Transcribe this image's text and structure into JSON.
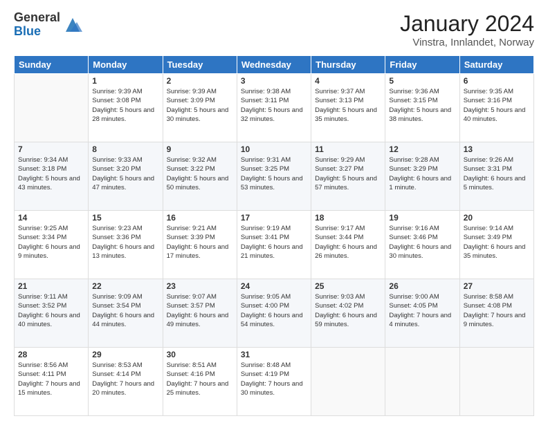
{
  "header": {
    "logo": {
      "general": "General",
      "blue": "Blue"
    },
    "title": "January 2024",
    "location": "Vinstra, Innlandet, Norway"
  },
  "calendar": {
    "days_of_week": [
      "Sunday",
      "Monday",
      "Tuesday",
      "Wednesday",
      "Thursday",
      "Friday",
      "Saturday"
    ],
    "weeks": [
      [
        {
          "day": "",
          "sunrise": "",
          "sunset": "",
          "daylight": ""
        },
        {
          "day": "1",
          "sunrise": "Sunrise: 9:39 AM",
          "sunset": "Sunset: 3:08 PM",
          "daylight": "Daylight: 5 hours and 28 minutes."
        },
        {
          "day": "2",
          "sunrise": "Sunrise: 9:39 AM",
          "sunset": "Sunset: 3:09 PM",
          "daylight": "Daylight: 5 hours and 30 minutes."
        },
        {
          "day": "3",
          "sunrise": "Sunrise: 9:38 AM",
          "sunset": "Sunset: 3:11 PM",
          "daylight": "Daylight: 5 hours and 32 minutes."
        },
        {
          "day": "4",
          "sunrise": "Sunrise: 9:37 AM",
          "sunset": "Sunset: 3:13 PM",
          "daylight": "Daylight: 5 hours and 35 minutes."
        },
        {
          "day": "5",
          "sunrise": "Sunrise: 9:36 AM",
          "sunset": "Sunset: 3:15 PM",
          "daylight": "Daylight: 5 hours and 38 minutes."
        },
        {
          "day": "6",
          "sunrise": "Sunrise: 9:35 AM",
          "sunset": "Sunset: 3:16 PM",
          "daylight": "Daylight: 5 hours and 40 minutes."
        }
      ],
      [
        {
          "day": "7",
          "sunrise": "Sunrise: 9:34 AM",
          "sunset": "Sunset: 3:18 PM",
          "daylight": "Daylight: 5 hours and 43 minutes."
        },
        {
          "day": "8",
          "sunrise": "Sunrise: 9:33 AM",
          "sunset": "Sunset: 3:20 PM",
          "daylight": "Daylight: 5 hours and 47 minutes."
        },
        {
          "day": "9",
          "sunrise": "Sunrise: 9:32 AM",
          "sunset": "Sunset: 3:22 PM",
          "daylight": "Daylight: 5 hours and 50 minutes."
        },
        {
          "day": "10",
          "sunrise": "Sunrise: 9:31 AM",
          "sunset": "Sunset: 3:25 PM",
          "daylight": "Daylight: 5 hours and 53 minutes."
        },
        {
          "day": "11",
          "sunrise": "Sunrise: 9:29 AM",
          "sunset": "Sunset: 3:27 PM",
          "daylight": "Daylight: 5 hours and 57 minutes."
        },
        {
          "day": "12",
          "sunrise": "Sunrise: 9:28 AM",
          "sunset": "Sunset: 3:29 PM",
          "daylight": "Daylight: 6 hours and 1 minute."
        },
        {
          "day": "13",
          "sunrise": "Sunrise: 9:26 AM",
          "sunset": "Sunset: 3:31 PM",
          "daylight": "Daylight: 6 hours and 5 minutes."
        }
      ],
      [
        {
          "day": "14",
          "sunrise": "Sunrise: 9:25 AM",
          "sunset": "Sunset: 3:34 PM",
          "daylight": "Daylight: 6 hours and 9 minutes."
        },
        {
          "day": "15",
          "sunrise": "Sunrise: 9:23 AM",
          "sunset": "Sunset: 3:36 PM",
          "daylight": "Daylight: 6 hours and 13 minutes."
        },
        {
          "day": "16",
          "sunrise": "Sunrise: 9:21 AM",
          "sunset": "Sunset: 3:39 PM",
          "daylight": "Daylight: 6 hours and 17 minutes."
        },
        {
          "day": "17",
          "sunrise": "Sunrise: 9:19 AM",
          "sunset": "Sunset: 3:41 PM",
          "daylight": "Daylight: 6 hours and 21 minutes."
        },
        {
          "day": "18",
          "sunrise": "Sunrise: 9:17 AM",
          "sunset": "Sunset: 3:44 PM",
          "daylight": "Daylight: 6 hours and 26 minutes."
        },
        {
          "day": "19",
          "sunrise": "Sunrise: 9:16 AM",
          "sunset": "Sunset: 3:46 PM",
          "daylight": "Daylight: 6 hours and 30 minutes."
        },
        {
          "day": "20",
          "sunrise": "Sunrise: 9:14 AM",
          "sunset": "Sunset: 3:49 PM",
          "daylight": "Daylight: 6 hours and 35 minutes."
        }
      ],
      [
        {
          "day": "21",
          "sunrise": "Sunrise: 9:11 AM",
          "sunset": "Sunset: 3:52 PM",
          "daylight": "Daylight: 6 hours and 40 minutes."
        },
        {
          "day": "22",
          "sunrise": "Sunrise: 9:09 AM",
          "sunset": "Sunset: 3:54 PM",
          "daylight": "Daylight: 6 hours and 44 minutes."
        },
        {
          "day": "23",
          "sunrise": "Sunrise: 9:07 AM",
          "sunset": "Sunset: 3:57 PM",
          "daylight": "Daylight: 6 hours and 49 minutes."
        },
        {
          "day": "24",
          "sunrise": "Sunrise: 9:05 AM",
          "sunset": "Sunset: 4:00 PM",
          "daylight": "Daylight: 6 hours and 54 minutes."
        },
        {
          "day": "25",
          "sunrise": "Sunrise: 9:03 AM",
          "sunset": "Sunset: 4:02 PM",
          "daylight": "Daylight: 6 hours and 59 minutes."
        },
        {
          "day": "26",
          "sunrise": "Sunrise: 9:00 AM",
          "sunset": "Sunset: 4:05 PM",
          "daylight": "Daylight: 7 hours and 4 minutes."
        },
        {
          "day": "27",
          "sunrise": "Sunrise: 8:58 AM",
          "sunset": "Sunset: 4:08 PM",
          "daylight": "Daylight: 7 hours and 9 minutes."
        }
      ],
      [
        {
          "day": "28",
          "sunrise": "Sunrise: 8:56 AM",
          "sunset": "Sunset: 4:11 PM",
          "daylight": "Daylight: 7 hours and 15 minutes."
        },
        {
          "day": "29",
          "sunrise": "Sunrise: 8:53 AM",
          "sunset": "Sunset: 4:14 PM",
          "daylight": "Daylight: 7 hours and 20 minutes."
        },
        {
          "day": "30",
          "sunrise": "Sunrise: 8:51 AM",
          "sunset": "Sunset: 4:16 PM",
          "daylight": "Daylight: 7 hours and 25 minutes."
        },
        {
          "day": "31",
          "sunrise": "Sunrise: 8:48 AM",
          "sunset": "Sunset: 4:19 PM",
          "daylight": "Daylight: 7 hours and 30 minutes."
        },
        {
          "day": "",
          "sunrise": "",
          "sunset": "",
          "daylight": ""
        },
        {
          "day": "",
          "sunrise": "",
          "sunset": "",
          "daylight": ""
        },
        {
          "day": "",
          "sunrise": "",
          "sunset": "",
          "daylight": ""
        }
      ]
    ]
  }
}
